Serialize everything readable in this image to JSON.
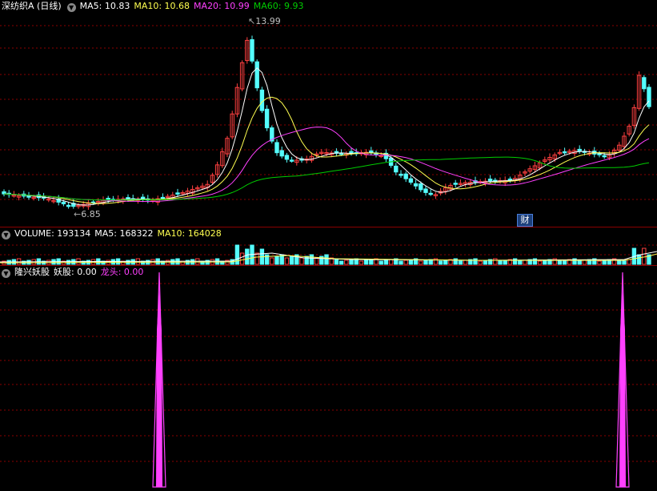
{
  "price_panel": {
    "title": "深纺织A (日线)",
    "ma5_label": "MA5: 10.83",
    "ma10_label": "MA10: 10.68",
    "ma20_label": "MA20: 10.99",
    "ma60_label": "MA60: 9.93",
    "high_label": "13.99",
    "low_label": "6.85",
    "finance_badge": "财"
  },
  "volume_panel": {
    "volume_label": "VOLUME: 193134",
    "ma5_label": "MA5: 168322",
    "ma10_label": "MA10: 164028"
  },
  "indicator_panel": {
    "name": "隆兴妖股",
    "yaogu_label": "妖股: 0.00",
    "longtou_label": "龙头: 0.00"
  },
  "colors": {
    "up": "#ff4040",
    "down": "#54fcfc",
    "ma5": "#ffffff",
    "ma10": "#ffff50",
    "ma20": "#ff40ff",
    "ma60": "#00cc00",
    "grid": "#8b0000",
    "signal": "#ff40ff"
  }
}
